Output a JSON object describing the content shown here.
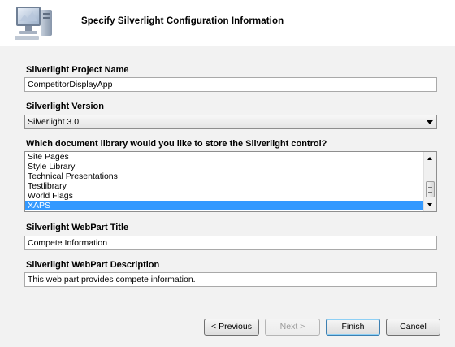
{
  "header": {
    "title": "Specify Silverlight Configuration Information",
    "icon": "computer-setup-icon"
  },
  "form": {
    "project_name": {
      "label": "Silverlight Project Name",
      "value": "CompetitorDisplayApp"
    },
    "version": {
      "label": "Silverlight Version",
      "selected": "Silverlight 3.0"
    },
    "library": {
      "label": "Which document library would you like to store the Silverlight control?",
      "items": [
        "Site Pages",
        "Style Library",
        "Technical Presentations",
        "Testlibrary",
        "World Flags",
        "XAPS"
      ],
      "selected": "XAPS"
    },
    "webpart_title": {
      "label": "Silverlight WebPart Title",
      "value": "Compete Information"
    },
    "webpart_description": {
      "label": "Silverlight WebPart Description",
      "value": "This web part provides compete information."
    }
  },
  "buttons": {
    "previous": "< Previous",
    "next": "Next >",
    "finish": "Finish",
    "cancel": "Cancel"
  },
  "colors": {
    "selection": "#3399ff",
    "panel": "#f2f2f2"
  }
}
